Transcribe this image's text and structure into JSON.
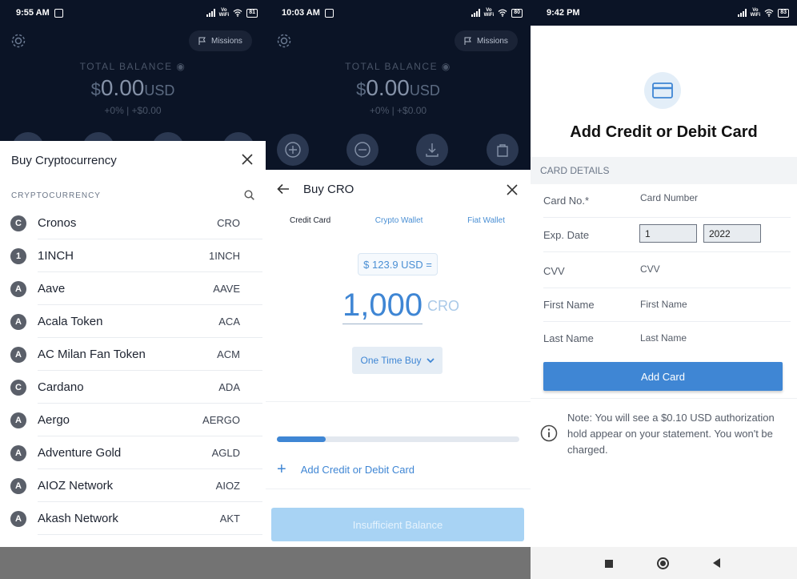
{
  "screen1": {
    "status": {
      "time": "9:55 AM",
      "volte": "Vo\nWiFi",
      "battery": "81"
    },
    "missions_label": "Missions",
    "total_label": "TOTAL BALANCE",
    "balance": {
      "currency_symbol": "$",
      "amount": "0.00",
      "unit": "USD"
    },
    "change": {
      "percent": "+0%",
      "amount": "+$0.00"
    },
    "sheet": {
      "title": "Buy Cryptocurrency",
      "section_label": "CRYPTOCURRENCY",
      "coins": [
        {
          "badge": "C",
          "name": "Cronos",
          "symbol": "CRO"
        },
        {
          "badge": "1",
          "name": "1INCH",
          "symbol": "1INCH"
        },
        {
          "badge": "A",
          "name": "Aave",
          "symbol": "AAVE"
        },
        {
          "badge": "A",
          "name": "Acala Token",
          "symbol": "ACA"
        },
        {
          "badge": "A",
          "name": "AC Milan Fan Token",
          "symbol": "ACM"
        },
        {
          "badge": "C",
          "name": "Cardano",
          "symbol": "ADA"
        },
        {
          "badge": "A",
          "name": "Aergo",
          "symbol": "AERGO"
        },
        {
          "badge": "A",
          "name": "Adventure Gold",
          "symbol": "AGLD"
        },
        {
          "badge": "A",
          "name": "AIOZ Network",
          "symbol": "AIOZ"
        },
        {
          "badge": "A",
          "name": "Akash Network",
          "symbol": "AKT"
        }
      ]
    }
  },
  "screen2": {
    "status": {
      "time": "10:03 AM",
      "volte": "Vo\nWiFi",
      "battery": "80"
    },
    "missions_label": "Missions",
    "total_label": "TOTAL BALANCE",
    "balance": {
      "currency_symbol": "$",
      "amount": "0.00",
      "unit": "USD"
    },
    "change": {
      "percent": "+0%",
      "amount": "+$0.00"
    },
    "sheet": {
      "title": "Buy CRO",
      "tabs": [
        {
          "label": "Credit Card",
          "active": true
        },
        {
          "label": "Crypto Wallet",
          "active": false
        },
        {
          "label": "Fiat Wallet",
          "active": false
        }
      ],
      "usd_equivalent": "$ 123.9 USD =",
      "amount": "1,000",
      "amount_unit": "CRO",
      "purchase_type": "One Time Buy",
      "progress": 0.2,
      "add_card_label": "Add Credit or Debit Card",
      "submit_label": "Insufficient Balance"
    }
  },
  "screen3": {
    "status": {
      "time": "9:42 PM",
      "volte": "Vo\nWiFi",
      "battery": "83"
    },
    "title": "Add Credit or Debit Card",
    "section_label": "CARD DETAILS",
    "fields": {
      "card_no": {
        "label": "Card No.*",
        "placeholder": "Card Number"
      },
      "exp_date": {
        "label": "Exp. Date",
        "month": "1",
        "year": "2022"
      },
      "cvv": {
        "label": "CVV",
        "placeholder": "CVV"
      },
      "first_name": {
        "label": "First Name",
        "placeholder": "First Name"
      },
      "last_name": {
        "label": "Last Name",
        "placeholder": "Last Name"
      }
    },
    "submit_label": "Add Card",
    "note": "Note: You will see a $0.10 USD authorization hold appear on your statement. You won't be charged."
  },
  "colors": {
    "accent": "#3f86d4",
    "dark_bg": "#0b1426",
    "disabled_button": "#a8d3f4"
  }
}
